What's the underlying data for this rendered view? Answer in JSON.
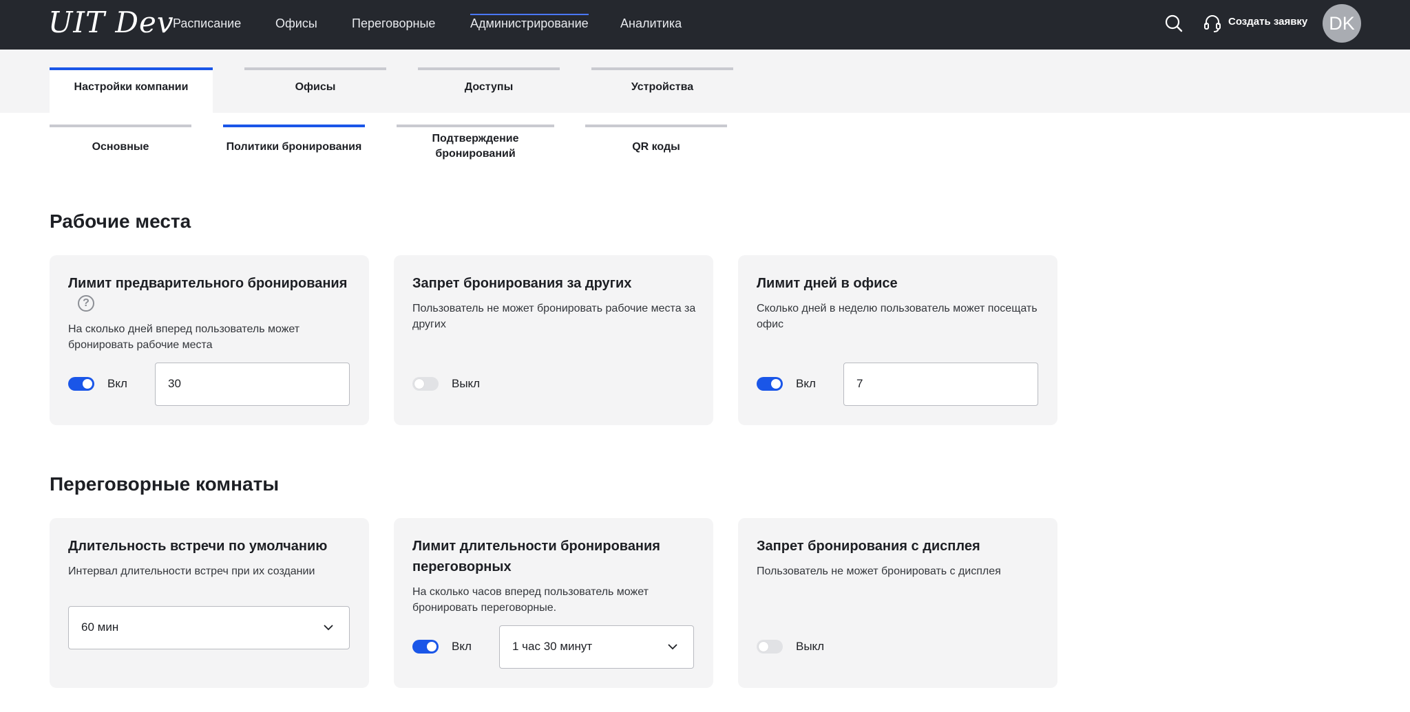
{
  "app": {
    "logo": "UIT Dev"
  },
  "nav": {
    "items": [
      {
        "label": "Расписание"
      },
      {
        "label": "Офисы"
      },
      {
        "label": "Переговорные"
      },
      {
        "label": "Администрирование",
        "active": true
      },
      {
        "label": "Аналитика"
      }
    ],
    "search_icon": "search-icon",
    "help_icon": "headset-icon",
    "create_ticket": "Создать заявку",
    "avatar_initials": "DK"
  },
  "tabs": [
    {
      "label": "Настройки компании",
      "active": true
    },
    {
      "label": "Офисы"
    },
    {
      "label": "Доступы"
    },
    {
      "label": "Устройства"
    }
  ],
  "subtabs": [
    {
      "label": "Основные"
    },
    {
      "label": "Политики бронирования",
      "active": true
    },
    {
      "label": "Подтверждение бронирований"
    },
    {
      "label": "QR коды"
    }
  ],
  "workplaces": {
    "title": "Рабочие места",
    "cards": [
      {
        "title": "Лимит предварительного бронирования",
        "help_icon": "question-icon",
        "help_glyph": "?",
        "desc": "На сколько дней вперед пользователь может бронировать рабочие места",
        "toggle_on": true,
        "toggle_label": "Вкл",
        "value": "30"
      },
      {
        "title": "Запрет бронирования за других",
        "desc": "Пользователь не может бронировать рабочие места за других",
        "toggle_on": false,
        "toggle_label": "Выкл"
      },
      {
        "title": "Лимит дней в офисе",
        "desc": "Сколько дней в неделю пользователь может посещать офис",
        "toggle_on": true,
        "toggle_label": "Вкл",
        "value": "7"
      }
    ]
  },
  "meeting_rooms": {
    "title": "Переговорные комнаты",
    "cards": [
      {
        "title": "Длительность встречи по умолчанию",
        "desc": "Интервал длительности встреч при их создании",
        "select_value": "60 мин"
      },
      {
        "title": "Лимит длительности бронирования переговорных",
        "desc": "На сколько часов вперед пользователь может бронировать переговорные.",
        "toggle_on": true,
        "toggle_label": "Вкл",
        "select_value": "1 час 30 минут"
      },
      {
        "title": "Запрет бронирования с дисплея",
        "desc": "Пользователь не может бронировать с дисплея",
        "toggle_on": false,
        "toggle_label": "Выкл"
      }
    ]
  },
  "colors": {
    "topbar": "#25282e",
    "accent": "#1a56e8",
    "card_bg": "#f4f4f5"
  }
}
